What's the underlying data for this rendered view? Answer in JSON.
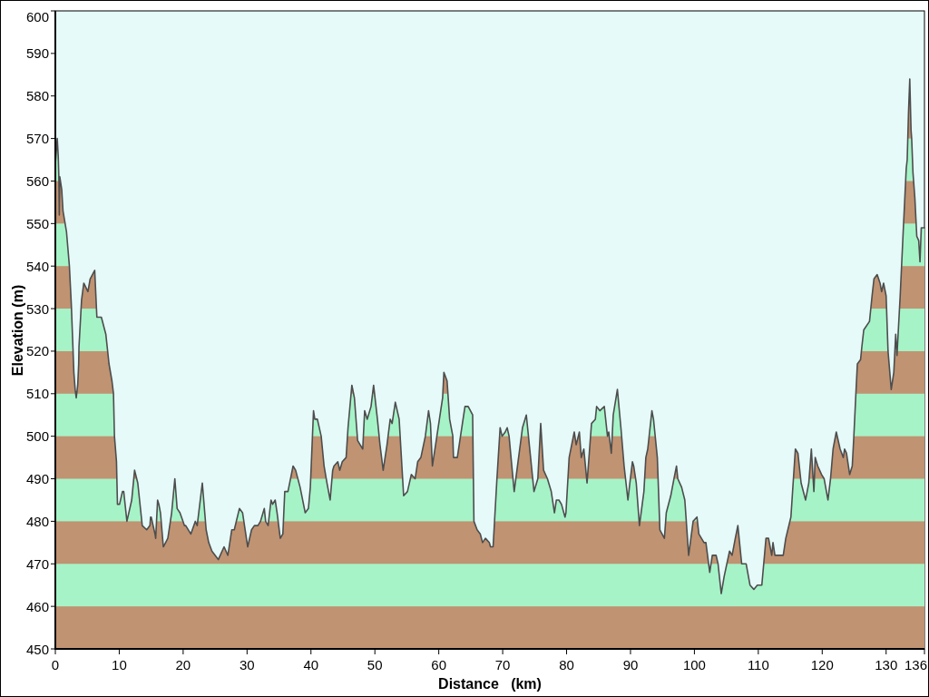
{
  "elevation_profile": {
    "chart_data": {
      "type": "area",
      "xlabel": "Distance   (km)",
      "ylabel": "Elevation (m)",
      "xlim": [
        0,
        136
      ],
      "ylim": [
        450,
        600
      ],
      "xticks": [
        0,
        10,
        20,
        30,
        40,
        50,
        60,
        70,
        80,
        90,
        100,
        110,
        120,
        130,
        136
      ],
      "yticks": [
        450,
        460,
        470,
        480,
        490,
        500,
        510,
        520,
        530,
        540,
        550,
        560,
        570,
        580,
        590,
        600
      ],
      "x": [
        0,
        0.3,
        0.45,
        0.55,
        0.62,
        0.7,
        1,
        1.2,
        1.75,
        2.2,
        2.5,
        2.7,
        2.9,
        3.1,
        3.27,
        3.5,
        3.65,
        3.7,
        4.1,
        4.45,
        5.1,
        5.45,
        6.16,
        6.5,
        7.2,
        7.9,
        8.4,
        8.86,
        9.1,
        9.25,
        9.57,
        9.72,
        10.05,
        10.5,
        10.7,
        11.2,
        11.95,
        12.4,
        12.9,
        13.6,
        14.3,
        14.8,
        14.9,
        15,
        15.6,
        15.7,
        16,
        16.2,
        16.45,
        16.9,
        17.6,
        18.2,
        18.7,
        19.06,
        19.5,
        20.2,
        20.4,
        21.2,
        21.9,
        22.2,
        23,
        23.6,
        24,
        24.5,
        25.5,
        26.4,
        27,
        27.6,
        28,
        28.8,
        29.3,
        30.1,
        30.7,
        31.15,
        31.7,
        32.1,
        32.7,
        32.9,
        33.3,
        33.75,
        34,
        34.4,
        34.7,
        35.2,
        35.6,
        35.9,
        36.4,
        37.2,
        37.6,
        38.3,
        39.1,
        39.6,
        39.9,
        40.4,
        40.6,
        41,
        41.6,
        42.05,
        42.5,
        43,
        43.4,
        43.6,
        44.2,
        44.5,
        44.9,
        45.5,
        45.8,
        46.4,
        46.8,
        47.3,
        47.7,
        48.1,
        48.4,
        48.8,
        49.4,
        49.8,
        50.4,
        50.8,
        51.3,
        51.9,
        52.4,
        52.7,
        53.2,
        53.8,
        54.5,
        55.1,
        55.7,
        56.3,
        56.7,
        57.2,
        57.9,
        58.4,
        58.7,
        59,
        59.5,
        60.1,
        60.6,
        60.8,
        61.3,
        61.7,
        62.2,
        62.3,
        62.9,
        63.4,
        64.1,
        64.6,
        65.3,
        65.5,
        66,
        66.5,
        66.85,
        67.3,
        67.9,
        68.1,
        68.5,
        69.1,
        69.6,
        69.9,
        70.4,
        70.7,
        71,
        71.8,
        72.4,
        73.1,
        73.7,
        74.3,
        74.9,
        75.5,
        75.95,
        76.4,
        77,
        77.6,
        78.1,
        78.4,
        78.8,
        79.2,
        79.75,
        79.9,
        80.4,
        81.2,
        81.5,
        82,
        82.3,
        82.7,
        83.2,
        83.9,
        84.5,
        84.7,
        85.2,
        85.9,
        86.4,
        86.6,
        87,
        87.3,
        87.95,
        88.5,
        89,
        89.6,
        89.9,
        90.3,
        90.5,
        90.9,
        91.4,
        92.1,
        92.4,
        92.7,
        93.35,
        93.6,
        94.2,
        94.6,
        95.3,
        95.6,
        96.3,
        96.8,
        97.2,
        97.4,
        98,
        98.5,
        99.1,
        99.8,
        100.4,
        100.7,
        101.5,
        101.8,
        102.4,
        102.8,
        103.4,
        103.7,
        104.2,
        104.65,
        105.5,
        105.9,
        106.4,
        106.8,
        107.4,
        108.1,
        108.7,
        109.3,
        109.85,
        110.55,
        111.2,
        111.6,
        112.1,
        112.3,
        112.6,
        113.9,
        114.3,
        115.1,
        115.8,
        116.2,
        116.7,
        117.4,
        117.9,
        118.3,
        118.7,
        118.9,
        119.3,
        119.9,
        120.3,
        120.9,
        121.3,
        121.7,
        122.2,
        122.8,
        123.3,
        123.5,
        123.8,
        124.3,
        124.7,
        124.95,
        125.3,
        125.5,
        126,
        126.2,
        126.5,
        127.4,
        127.8,
        128.1,
        128.6,
        129.05,
        129.3,
        129.6,
        130,
        130.3,
        130.8,
        131.2,
        131.5,
        131.7,
        132.2,
        132.7,
        133.15,
        133.3,
        133.5,
        133.7,
        133.9,
        134,
        134.2,
        134.5,
        134.8,
        135.1,
        135.3,
        135.5,
        136
      ],
      "values": [
        564,
        570,
        566,
        561,
        552,
        561,
        558,
        553,
        548,
        540,
        531,
        523,
        515,
        511,
        509,
        512,
        517,
        521,
        532,
        536,
        534,
        537,
        539,
        528,
        528,
        524,
        517,
        513,
        510,
        500,
        494,
        484,
        484,
        487,
        487,
        480,
        485,
        492,
        489,
        479,
        478,
        479,
        481,
        481,
        477,
        476,
        485,
        484,
        482,
        474,
        476,
        482,
        490,
        483,
        482,
        479,
        479,
        477,
        480,
        479,
        489,
        478,
        475,
        473,
        471,
        474,
        472,
        478,
        478,
        483,
        482,
        474,
        478,
        479,
        479,
        480,
        483,
        480,
        479,
        485,
        484,
        485,
        482,
        476,
        477,
        487,
        487,
        493,
        492,
        488,
        482,
        483,
        488,
        506,
        504,
        504,
        500,
        493,
        489,
        485,
        492,
        493,
        494,
        492,
        494,
        495,
        502,
        512,
        509,
        499,
        498,
        497,
        506,
        504,
        507,
        512,
        504,
        498,
        492,
        498,
        504,
        503,
        508,
        504,
        486,
        487,
        491,
        490,
        494,
        495,
        500,
        506,
        503,
        493,
        498,
        504,
        509,
        515,
        513,
        504,
        500,
        495,
        495,
        500,
        507,
        507,
        505,
        480,
        478,
        477,
        475,
        476,
        475,
        474,
        474,
        490,
        502,
        500,
        501,
        502,
        500,
        487,
        494,
        502,
        505,
        496,
        487,
        490,
        503,
        492,
        490,
        487,
        482,
        485,
        485,
        484,
        481,
        482,
        495,
        501,
        498,
        501,
        495,
        497,
        489,
        503,
        504,
        507,
        506,
        507,
        500,
        501,
        496,
        505,
        511,
        502,
        493,
        485,
        489,
        494,
        493,
        489,
        479,
        487,
        495,
        497,
        506,
        504,
        495,
        478,
        476,
        482,
        486,
        490,
        493,
        490,
        488,
        485,
        472,
        480,
        481,
        477,
        475,
        475,
        468,
        472,
        472,
        470,
        463,
        467,
        473,
        472,
        476,
        479,
        470,
        470,
        465,
        464,
        465,
        465,
        476,
        476,
        472,
        475,
        472,
        472,
        476,
        481,
        497,
        496,
        489,
        485,
        489,
        497,
        487,
        495,
        493,
        491,
        490,
        485,
        490,
        497,
        501,
        497,
        495,
        497,
        496,
        491,
        493,
        500,
        511,
        517,
        518,
        521,
        525,
        527,
        533,
        537,
        538,
        536,
        534,
        536,
        533,
        520,
        511,
        515,
        524,
        519,
        533,
        549,
        563,
        565,
        576,
        584,
        572,
        570,
        562,
        556,
        547,
        546,
        541,
        549,
        549
      ]
    }
  }
}
